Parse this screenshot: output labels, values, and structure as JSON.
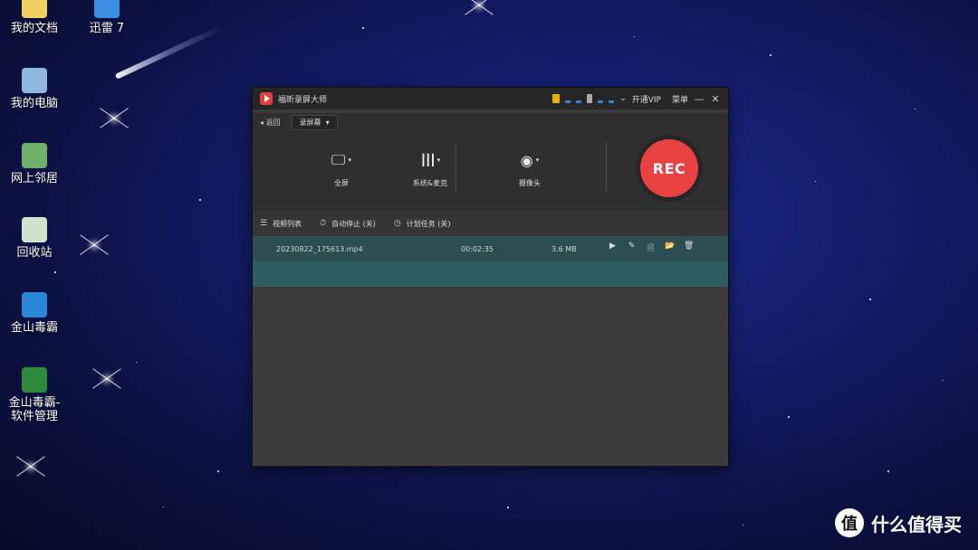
{
  "desktop": {
    "icons": [
      {
        "label": "我的文档"
      },
      {
        "label": "迅雷 7"
      },
      {
        "label": "我的电脑"
      },
      {
        "label": "网上邻居"
      },
      {
        "label": "回收站"
      },
      {
        "label": "金山毒霸"
      },
      {
        "label": "金山毒霸-\n软件管理"
      }
    ]
  },
  "app": {
    "title": "福昕录屏大师",
    "titlebar": {
      "vip_label": "开通VIP",
      "menu_label": "菜单",
      "minimize_glyph": "—",
      "close_glyph": "✕",
      "chevron_glyph": "⌄"
    },
    "back_label": "返回",
    "mode_dropdown": "录屏幕",
    "controls": [
      {
        "label": "全屏",
        "glyph": "🖵"
      },
      {
        "label": "系统&麦克",
        "glyph": "┃┃┃"
      },
      {
        "label": "摄像头",
        "glyph": "◉"
      }
    ],
    "rec_label": "REC",
    "toolbar": [
      {
        "label": "视频列表",
        "glyph": "☰"
      },
      {
        "label": "自动停止 (关)",
        "glyph": "⏱"
      },
      {
        "label": "计划任务 (关)",
        "glyph": "◷"
      }
    ],
    "files": [
      {
        "name": "20230822_175613.mp4",
        "duration": "00:02:35",
        "size": "3.6 MB"
      }
    ],
    "row_actions": [
      "▶",
      "✎",
      "🗎",
      "📂",
      "🗑"
    ]
  },
  "watermark": {
    "text": "什么值得买",
    "logo": "值"
  },
  "colors": {
    "rec": "#e8413f",
    "row_selected": "#2c4e52",
    "row_highlight": "#2d5b60",
    "desktop_bg": "#141c6a"
  }
}
